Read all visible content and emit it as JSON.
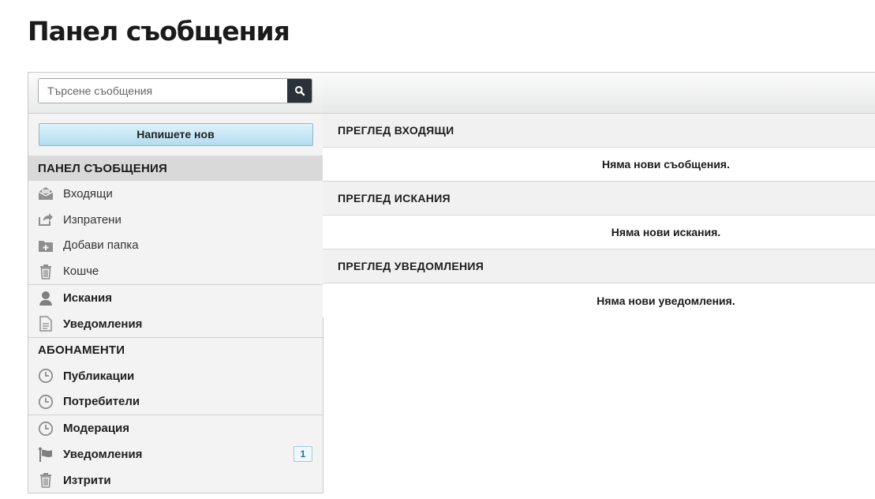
{
  "page": {
    "title": "Панел съобщения"
  },
  "search": {
    "placeholder": "Търсене съобщения",
    "value": ""
  },
  "compose": {
    "label": "Напишете нов"
  },
  "sidebar": {
    "messages_section": "ПАНЕЛ СЪОБЩЕНИЯ",
    "folders": [
      {
        "label": "Входящи",
        "icon": "inbox-icon"
      },
      {
        "label": "Изпратени",
        "icon": "sent-icon"
      },
      {
        "label": "Добави папка",
        "icon": "add-folder-icon"
      },
      {
        "label": "Кошче",
        "icon": "trash-icon"
      }
    ],
    "requests": {
      "label": "Искания",
      "icon": "user-icon"
    },
    "notifications": {
      "label": "Уведомления",
      "icon": "document-icon"
    },
    "subscriptions_section": "АБОНАМЕНТИ",
    "subscriptions": [
      {
        "label": "Публикации",
        "icon": "clock-icon"
      },
      {
        "label": "Потребители",
        "icon": "clock-icon"
      }
    ],
    "moderation": {
      "label": "Модерация",
      "icon": "clock-icon"
    },
    "flag_notifications": {
      "label": "Уведомления",
      "icon": "flag-icon",
      "badge": "1"
    },
    "deleted": {
      "label": "Изтрити",
      "icon": "trash-icon"
    }
  },
  "panels": [
    {
      "title": "ПРЕГЛЕД ВХОДЯЩИ",
      "message": "Няма нови съобщения."
    },
    {
      "title": "ПРЕГЛЕД ИСКАНИЯ",
      "message": "Няма нови искания."
    },
    {
      "title": "ПРЕГЛЕД УВЕДОМЛЕНИЯ",
      "message": "Няма нови уведомления."
    }
  ],
  "colors": {
    "accent": "#2b3138",
    "compose_top": "#def3fc",
    "compose_bottom": "#b3dcef",
    "badge_text": "#2a6f96"
  }
}
